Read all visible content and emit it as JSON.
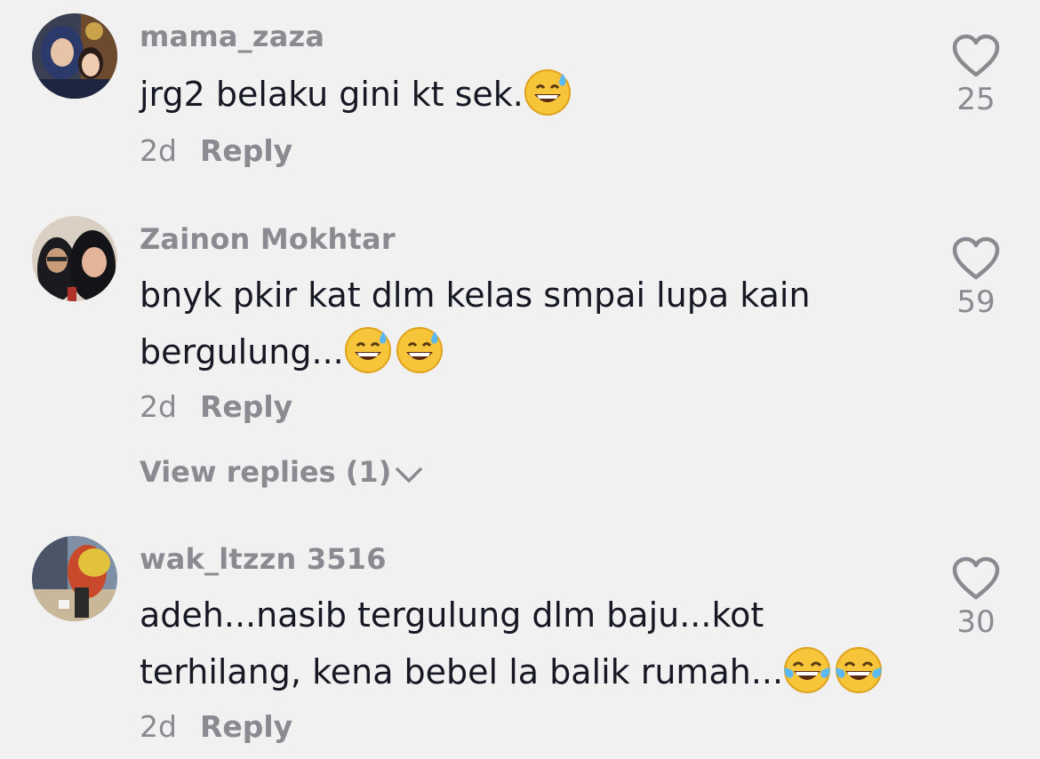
{
  "comments": [
    {
      "username": "mama_zaza",
      "text": "jrg2 belaku gini kt sek.",
      "time": "2d",
      "reply_label": "Reply",
      "likes": "25",
      "emojis": [
        "sweat-smile-emoji"
      ]
    },
    {
      "username": "Zainon Mokhtar",
      "text_line1": "bnyk pkir kat dlm kelas smpai lupa kain",
      "text_line2": "bergulung...",
      "time": "2d",
      "reply_label": "Reply",
      "likes": "59",
      "view_replies": "View replies (1)",
      "emojis": [
        "sweat-smile-emoji",
        "sweat-smile-emoji"
      ]
    },
    {
      "username": "wak_ltzzn 3516",
      "text_line1": "adeh...nasib tergulung dlm baju...kot",
      "text_line2": "terhilang, kena bebel la balik rumah...",
      "time": "2d",
      "reply_label": "Reply",
      "likes": "30",
      "emojis": [
        "tears-of-joy-emoji",
        "tears-of-joy-emoji"
      ]
    }
  ],
  "colors": {
    "background": "#f1f1f2",
    "primary_text": "#161823",
    "secondary_text": "#8a8b91"
  }
}
